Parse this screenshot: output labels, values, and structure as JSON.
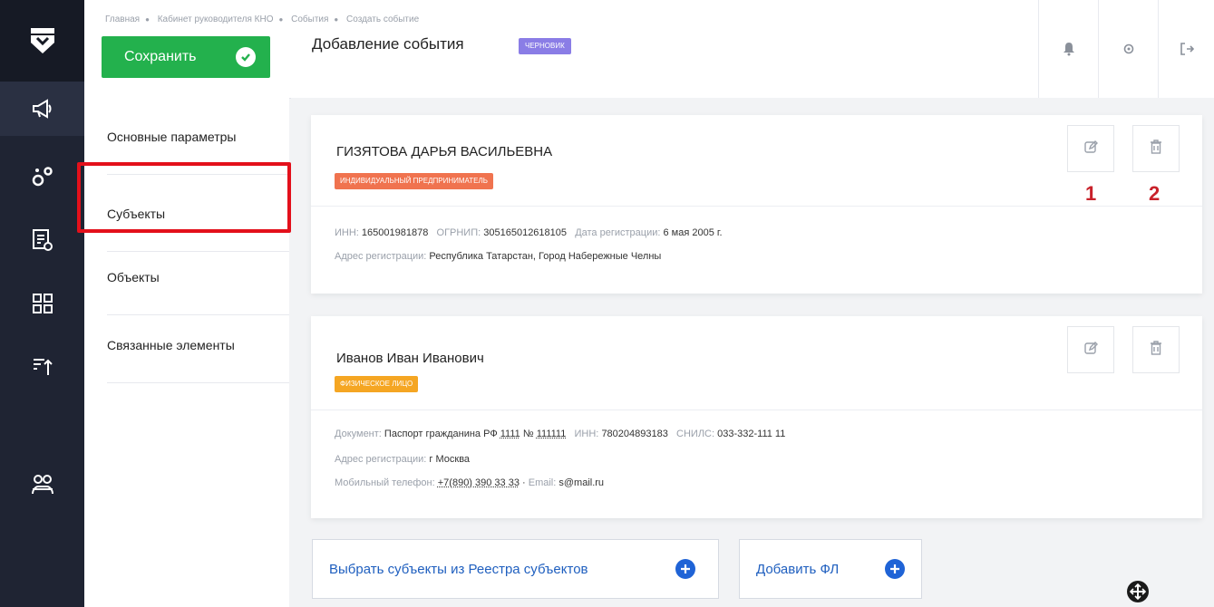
{
  "breadcrumbs": [
    "Главная",
    "Кабинет руководителя КНО",
    "События",
    "Создать событие"
  ],
  "header": {
    "save_label": "Сохранить",
    "title": "Добавление события",
    "status_badge": "ЧЕРНОВИК"
  },
  "rail": {
    "icons": [
      "shield-logo-icon",
      "megaphone-icon",
      "gears-icon",
      "document-search-icon",
      "grid-icon",
      "sort-icon",
      "users-icon"
    ]
  },
  "top_icons": [
    "bell-icon",
    "settings-icon",
    "logout-icon"
  ],
  "side_nav": {
    "items": [
      {
        "label": "Основные параметры"
      },
      {
        "label": "Субъекты"
      },
      {
        "label": "Объекты"
      },
      {
        "label": "Связанные элементы"
      }
    ],
    "selected": "Субъекты"
  },
  "subjects": [
    {
      "name": "ГИЗЯТОВА ДАРЬЯ ВАСИЛЬЕВНА",
      "type": "ИНДИВИДУАЛЬНЫЙ ПРЕДПРИНИМАТЕЛЬ",
      "type_color": "#f0734f",
      "inn_label": "ИНН:",
      "inn": "165001981878",
      "ogrnip_label": "ОГРНИП:",
      "ogrnip": "305165012618105",
      "reg_date_label": "Дата регистрации:",
      "reg_date": "6 мая 2005 г.",
      "address_label": "Адрес регистрации:",
      "address": "Республика Татарстан, Город Набережные Челны",
      "edit_marker": "1",
      "delete_marker": "2"
    },
    {
      "name": "Иванов Иван Иванович",
      "type": "ФИЗИЧЕСКОЕ ЛИЦО",
      "type_color": "#f5a623",
      "doc_label": "Документ:",
      "doc": "Паспорт гражданина РФ",
      "doc_series": "1111",
      "doc_no_label": "№",
      "doc_no": "111111",
      "inn_label": "ИНН:",
      "inn": "780204893183",
      "snils_label": "СНИЛС:",
      "snils": "033-332-111 11",
      "address_label": "Адрес регистрации:",
      "address": "г Москва",
      "phone_label": "Мобильный телефон:",
      "phone": "+7(890) 390 33 33",
      "email_label": "Email:",
      "email": "s@mail.ru"
    }
  ],
  "actions": {
    "select_registry": "Выбрать субъекты из Реестра субъектов",
    "add_person": "Добавить ФЛ"
  },
  "colors": {
    "accent_green": "#23b14d",
    "highlight_red": "#e3101b",
    "primary_blue": "#1f63d6",
    "rail_bg": "#1f2433"
  }
}
